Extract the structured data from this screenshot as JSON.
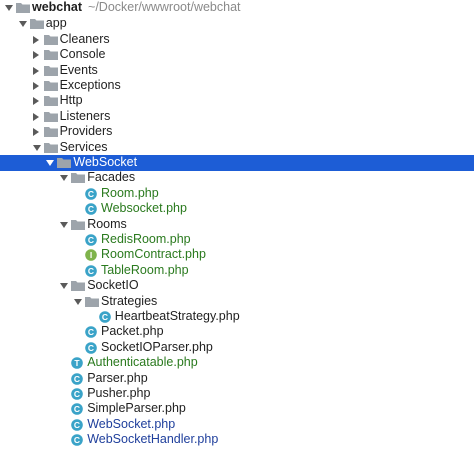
{
  "colors": {
    "selection": "#1d5dd6",
    "folder": "#9da4ab",
    "php_class_icon": "#3aa3c8",
    "php_interface_icon": "#7fb34c",
    "php_trait_icon": "#3aa3c8",
    "vcs_added": "#2a7a1e",
    "vcs_modified": "#1f3f9c"
  },
  "tree": {
    "root": {
      "label": "webchat",
      "path": "~/Docker/wwwroot/webchat"
    },
    "nodes": [
      {
        "label": "app",
        "depth": 1,
        "arrow": "down",
        "icon": "folder-icon",
        "vcs": "none"
      },
      {
        "label": "Cleaners",
        "depth": 2,
        "arrow": "right",
        "icon": "folder-icon",
        "vcs": "none"
      },
      {
        "label": "Console",
        "depth": 2,
        "arrow": "right",
        "icon": "folder-icon",
        "vcs": "none"
      },
      {
        "label": "Events",
        "depth": 2,
        "arrow": "right",
        "icon": "folder-icon",
        "vcs": "none"
      },
      {
        "label": "Exceptions",
        "depth": 2,
        "arrow": "right",
        "icon": "folder-icon",
        "vcs": "none"
      },
      {
        "label": "Http",
        "depth": 2,
        "arrow": "right",
        "icon": "folder-icon",
        "vcs": "none"
      },
      {
        "label": "Listeners",
        "depth": 2,
        "arrow": "right",
        "icon": "folder-icon",
        "vcs": "none"
      },
      {
        "label": "Providers",
        "depth": 2,
        "arrow": "right",
        "icon": "folder-icon",
        "vcs": "none"
      },
      {
        "label": "Services",
        "depth": 2,
        "arrow": "down",
        "icon": "folder-icon",
        "vcs": "none"
      },
      {
        "label": "WebSocket",
        "depth": 3,
        "arrow": "down",
        "icon": "folder-icon",
        "vcs": "none",
        "selected": true
      },
      {
        "label": "Facades",
        "depth": 4,
        "arrow": "down",
        "icon": "folder-icon",
        "vcs": "none"
      },
      {
        "label": "Room.php",
        "depth": 5,
        "arrow": "none",
        "icon": "php-class-icon",
        "vcs": "added"
      },
      {
        "label": "Websocket.php",
        "depth": 5,
        "arrow": "none",
        "icon": "php-class-icon",
        "vcs": "added"
      },
      {
        "label": "Rooms",
        "depth": 4,
        "arrow": "down",
        "icon": "folder-icon",
        "vcs": "none"
      },
      {
        "label": "RedisRoom.php",
        "depth": 5,
        "arrow": "none",
        "icon": "php-class-icon",
        "vcs": "added"
      },
      {
        "label": "RoomContract.php",
        "depth": 5,
        "arrow": "none",
        "icon": "php-interface-icon",
        "vcs": "added"
      },
      {
        "label": "TableRoom.php",
        "depth": 5,
        "arrow": "none",
        "icon": "php-class-icon",
        "vcs": "added"
      },
      {
        "label": "SocketIO",
        "depth": 4,
        "arrow": "down",
        "icon": "folder-icon",
        "vcs": "none"
      },
      {
        "label": "Strategies",
        "depth": 5,
        "arrow": "down",
        "icon": "folder-icon",
        "vcs": "none"
      },
      {
        "label": "HeartbeatStrategy.php",
        "depth": 6,
        "arrow": "none",
        "icon": "php-class-icon",
        "vcs": "none"
      },
      {
        "label": "Packet.php",
        "depth": 5,
        "arrow": "none",
        "icon": "php-class-icon",
        "vcs": "none"
      },
      {
        "label": "SocketIOParser.php",
        "depth": 5,
        "arrow": "none",
        "icon": "php-class-icon",
        "vcs": "none"
      },
      {
        "label": "Authenticatable.php",
        "depth": 4,
        "arrow": "none",
        "icon": "php-trait-icon",
        "vcs": "added"
      },
      {
        "label": "Parser.php",
        "depth": 4,
        "arrow": "none",
        "icon": "php-class-icon",
        "vcs": "none"
      },
      {
        "label": "Pusher.php",
        "depth": 4,
        "arrow": "none",
        "icon": "php-class-icon",
        "vcs": "none"
      },
      {
        "label": "SimpleParser.php",
        "depth": 4,
        "arrow": "none",
        "icon": "php-class-icon",
        "vcs": "none"
      },
      {
        "label": "WebSocket.php",
        "depth": 4,
        "arrow": "none",
        "icon": "php-class-icon",
        "vcs": "modified"
      },
      {
        "label": "WebSocketHandler.php",
        "depth": 4,
        "arrow": "none",
        "icon": "php-class-icon",
        "vcs": "modified"
      }
    ]
  }
}
